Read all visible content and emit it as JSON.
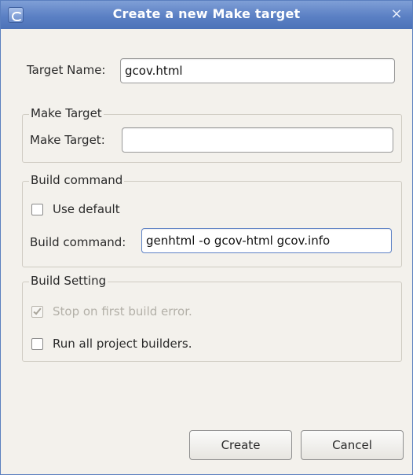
{
  "window": {
    "title": "Create a new Make target",
    "close_symbol": "×",
    "app_icon": "eclipse-icon",
    "close_icon": "close-icon"
  },
  "target_name": {
    "label": "Target Name:",
    "value": "gcov.html"
  },
  "make_target_group": {
    "title": "Make Target",
    "label": "Make Target:",
    "value": ""
  },
  "build_command_group": {
    "title": "Build command",
    "use_default_label": "Use default",
    "use_default_checked": false,
    "command_label": "Build command:",
    "command_value": "genhtml -o gcov-html gcov.info"
  },
  "build_setting_group": {
    "title": "Build Setting",
    "stop_on_error_label": "Stop on first build error.",
    "stop_on_error_checked": true,
    "stop_on_error_enabled": false,
    "run_all_label": "Run all project builders.",
    "run_all_checked": false
  },
  "buttons": {
    "create": "Create",
    "cancel": "Cancel"
  },
  "colors": {
    "titlebar": "#5b80c4",
    "dialog_bg": "#f3f1ec",
    "focus_border": "#5e82c5"
  }
}
